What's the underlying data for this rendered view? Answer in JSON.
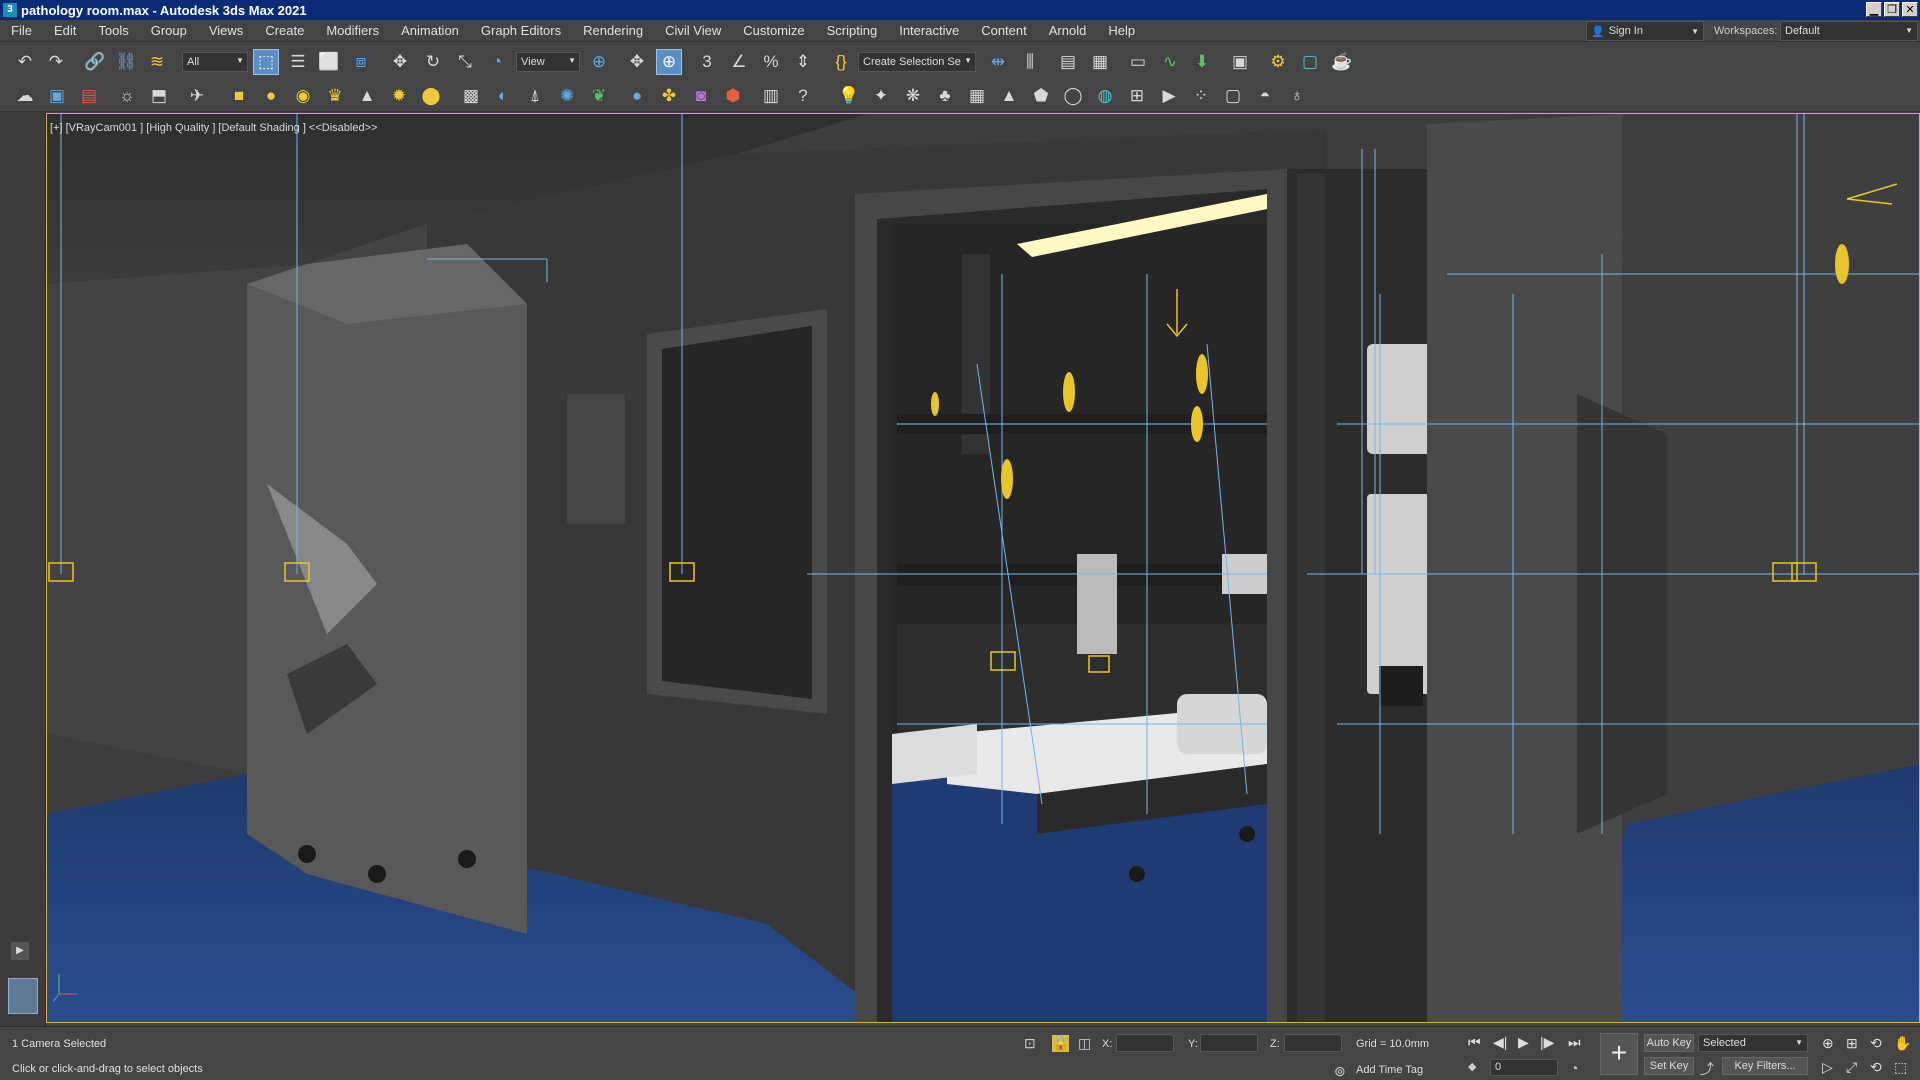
{
  "titlebar": {
    "app_icon": "3",
    "title": "pathology room.max - Autodesk 3ds Max 2021",
    "minimize": "▁",
    "restore": "❐",
    "close": "✕"
  },
  "menubar": {
    "items": [
      "File",
      "Edit",
      "Tools",
      "Group",
      "Views",
      "Create",
      "Modifiers",
      "Animation",
      "Graph Editors",
      "Rendering",
      "Civil View",
      "Customize",
      "Scripting",
      "Interactive",
      "Content",
      "Arnold",
      "Help"
    ],
    "sign_in": "Sign In",
    "workspaces_label": "Workspaces:",
    "workspace_value": "Default"
  },
  "toolbar": {
    "selection_filter": "All",
    "ref_coord": "View",
    "named_selection": "Create Selection Se"
  },
  "icons": {
    "undo": "↶",
    "redo": "↷",
    "link": "🔗",
    "unlink": "⛓",
    "bind": "≋",
    "select": "⬚",
    "select_by_name": "☰",
    "rect_region": "⬜",
    "window_crossing": "⧈",
    "move": "✥",
    "rotate": "↻",
    "scale": "⤡",
    "placement": "◔",
    "pivot": "⊕",
    "snap": "⊞",
    "snap3": "3",
    "angle_snap": "∠",
    "percent_snap": "%",
    "spinner_snap": "⇕",
    "edit_named": "{}",
    "mirror": "⇹",
    "align": "⫼",
    "layer": "▤",
    "scene_explorer": "▦",
    "ribbon": "▭",
    "curve_editor": "∿",
    "schematic": "⬇",
    "material": "▣",
    "render_setup": "⚙",
    "render_frame": "▢",
    "render": "☕",
    "t2_1": "☁",
    "t2_2": "▣",
    "t2_3": "▤",
    "t2_4": "☼",
    "t2_5": "⬒",
    "t2_6": "✈",
    "t2_7": "■",
    "t2_8": "●",
    "t2_9": "◉",
    "t2_10": "♛",
    "t2_11": "▲",
    "t2_12": "✹",
    "t2_13": "⬤",
    "t2_14": "▩",
    "t2_15": "◐",
    "t2_16": "⍋",
    "t2_17": "✺",
    "t2_18": "❦",
    "t2_19": "●",
    "t2_20": "✤",
    "t2_21": "◙",
    "t2_22": "⬢",
    "t2_23": "▥",
    "t2_24": "?",
    "t2_25": "💡",
    "t2_26": "✦",
    "t2_27": "❋",
    "t2_28": "♣",
    "t2_29": "▦",
    "t2_30": "▲",
    "t2_31": "⬟",
    "t2_32": "◯",
    "t2_33": "◍",
    "t2_34": "⊞",
    "t2_35": "▶",
    "t2_36": "⁘",
    "t2_37": "▢",
    "t2_38": "◓",
    "t2_39": "♁",
    "play": "▶",
    "lock": "🔒",
    "abs_rel": "⊡",
    "select_lock": "◫",
    "go_start": "⏮",
    "prev_frame": "◀|",
    "play_anim": "▶",
    "next_frame": "|▶",
    "go_end": "⏭",
    "key_mode": "+",
    "zoom": "⊕",
    "zoom_all": "⊞",
    "orbit": "⟲",
    "pan": "✋",
    "fov": "▷",
    "walk": "⤢",
    "maximize": "⬚",
    "time_config": "◔",
    "add_time_tag": "⊚"
  },
  "viewport": {
    "label": "[+] [VRayCam001 ] [High Quality ] [Default Shading ]  <<Disabled>>",
    "axis_x": "x",
    "axis_y": "y",
    "axis_z": "z"
  },
  "statusbar": {
    "selection": "1 Camera Selected",
    "prompt": "Click or click-and-drag to select objects",
    "x_label": "X:",
    "y_label": "Y:",
    "z_label": "Z:",
    "grid": "Grid = 10.0mm",
    "add_time_tag": "Add Time Tag",
    "frame_value": "0",
    "auto_key": "Auto Key",
    "set_key": "Set Key",
    "selected": "Selected",
    "key_filters": "Key Filters..."
  }
}
